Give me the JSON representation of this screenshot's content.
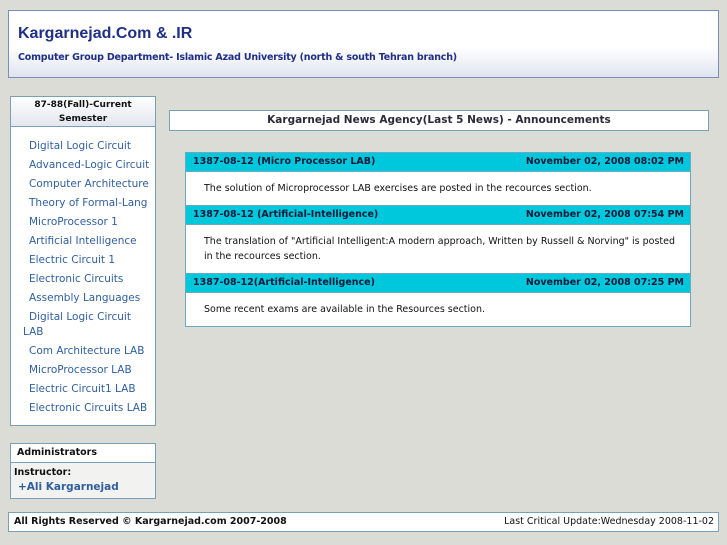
{
  "header": {
    "title": "Kargarnejad.Com & .IR",
    "subtitle": "Computer Group Department- Islamic Azad University (north & south Tehran branch)"
  },
  "sidebar": {
    "semester_title_line1": "87-88(Fall)-Current",
    "semester_title_line2": "Semester",
    "courses": [
      "Digital Logic Circuit",
      "Advanced-Logic Circuit",
      "Computer Architecture",
      "Theory of Formal-Lang",
      "MicroProcessor 1",
      "Artificial Intelligence",
      "Electric Circuit 1",
      "Electronic Circuits",
      "Assembly Languages",
      "Digital Logic Circuit",
      "LAB",
      "Com Architecture LAB",
      "MicroProcessor LAB",
      "Electric Circuit1 LAB",
      "Electronic Circuits LAB"
    ],
    "admin_title": "Administrators",
    "instructor_label": "Instructor:",
    "instructor_name": "+Ali Kargarnejad"
  },
  "news": {
    "section_title": "Kargarnejad News Agency(Last 5 News) - Announcements",
    "items": [
      {
        "heading": "1387-08-12 (Micro Processor LAB)",
        "date": "November 02, 2008 08:02 PM",
        "body": "The solution of Microprocessor LAB exercises are posted in the recources section."
      },
      {
        "heading": "1387-08-12 (Artificial-Intelligence)",
        "date": "November 02, 2008 07:54 PM",
        "body": "The translation of \"Artificial Intelligent:A modern approach, Written by Russell & Norving\" is posted in the recources section."
      },
      {
        "heading": "1387-08-12(Artificial-Intelligence)",
        "date": "November 02, 2008 07:25 PM",
        "body": "Some recent exams are available in the Resources section."
      }
    ]
  },
  "footer": {
    "copyright": "All Rights Reserved © Kargarnejad.com 2007-2008",
    "last_update": "Last Critical Update:Wednesday 2008-11-02"
  }
}
